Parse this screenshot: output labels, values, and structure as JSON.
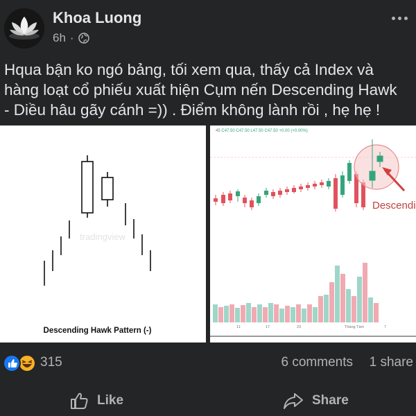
{
  "post": {
    "author": "Khoa Luong",
    "time": "6h",
    "separator": "·",
    "visibility_icon": "globe-icon",
    "text_lines": [
      "Hqua bận ko ngó bảng, tối xem qua, thấy cả Index và",
      "hàng loạt cổ phiếu xuất hiện Cụm nến  Descending Hawk",
      "- Diều hâu gãy cánh =)) . Điểm không lành rồi , hẹ hẹ !"
    ]
  },
  "images": {
    "left": {
      "caption": "Descending Hawk Pattern (-)",
      "watermark": "tradingview"
    },
    "right": {
      "toolbar_values": [
        "45",
        "C47.50",
        "C47.50",
        "L47.50",
        "C47.50",
        "+0.00 (+0.00%)"
      ],
      "callout_label": "Descending",
      "x_labels": [
        "11",
        "17",
        "23",
        "Tháng Tám",
        "7"
      ],
      "colors": {
        "up": "#35a47c",
        "down": "#e0535d",
        "vol_up": "#9fd6c9",
        "vol_down": "#f1aab1",
        "highlight": "#f6c9c9"
      }
    }
  },
  "stats": {
    "reaction_icons": [
      "like-reaction-icon",
      "haha-reaction-icon"
    ],
    "reaction_count": "315",
    "comments": "6 comments",
    "shares": "1 share"
  },
  "actions": {
    "like_label": "Like",
    "share_label": "Share"
  }
}
